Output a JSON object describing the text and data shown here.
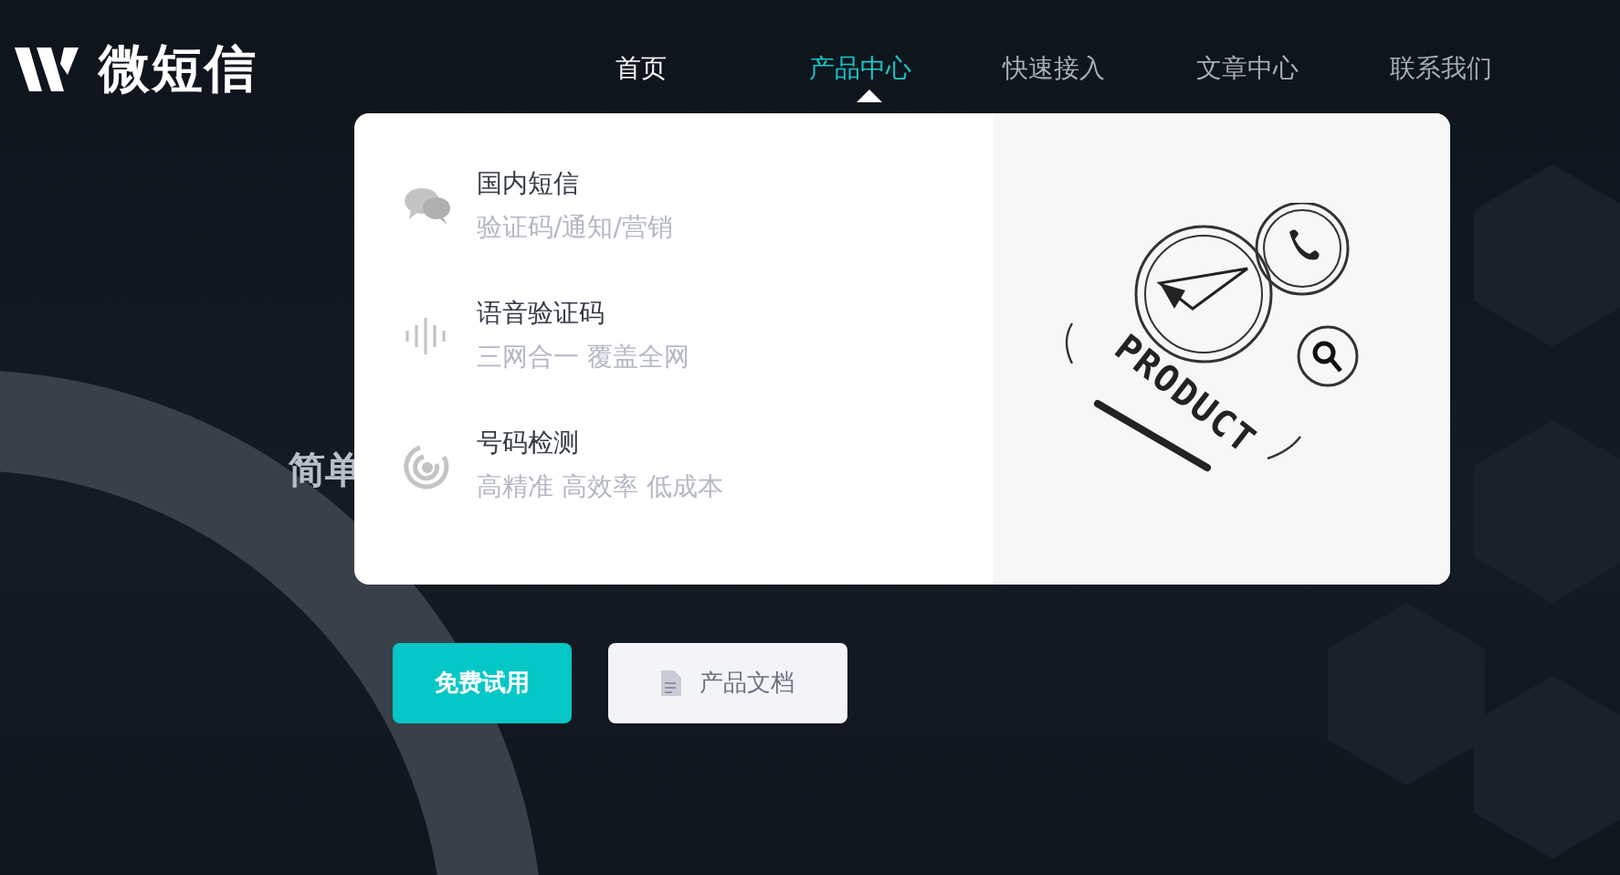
{
  "logo": {
    "text": "微短信"
  },
  "nav": [
    {
      "label": "首页",
      "selected": false,
      "current": true
    },
    {
      "label": "产品中心",
      "selected": true,
      "current": false
    },
    {
      "label": "快速接入",
      "selected": false,
      "current": false
    },
    {
      "label": "文章中心",
      "selected": false,
      "current": false
    },
    {
      "label": "联系我们",
      "selected": false,
      "current": false
    }
  ],
  "hero": {
    "heading": "简单"
  },
  "dropdown": {
    "expanded": true,
    "items": [
      {
        "kind": "chat",
        "title": "国内短信",
        "subtitle": "验证码/通知/营销"
      },
      {
        "kind": "voice",
        "title": "语音验证码",
        "subtitle": "三网合一 覆盖全网"
      },
      {
        "kind": "radar",
        "title": "号码检测",
        "subtitle": "高精准 高效率 低成本"
      }
    ],
    "illustration": {
      "caption": "PRODUCT"
    }
  },
  "buttons": [
    {
      "kind": "primary",
      "label": "免费试用"
    },
    {
      "kind": "secondary",
      "label": "产品文档"
    }
  ]
}
